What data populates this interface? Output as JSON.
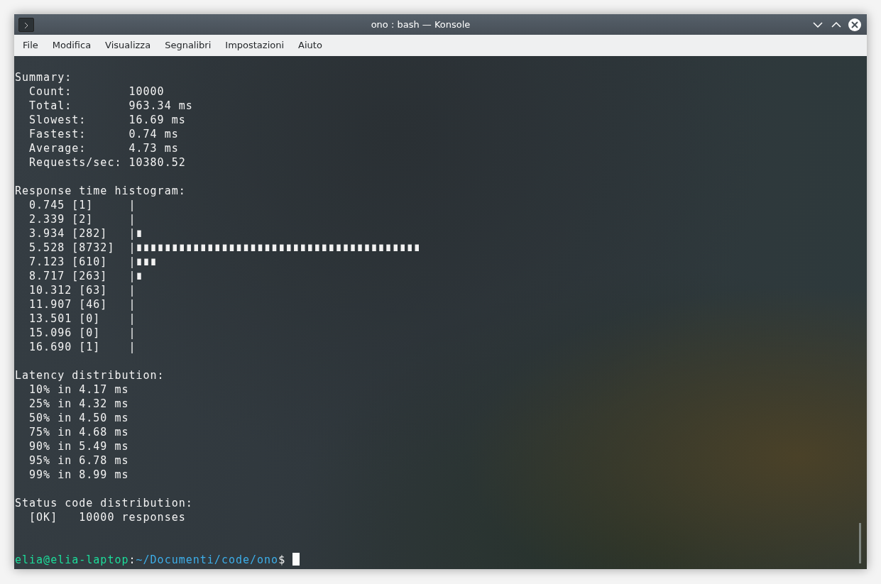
{
  "window": {
    "title": "ono : bash — Konsole"
  },
  "menu": [
    "File",
    "Modifica",
    "Visualizza",
    "Segnalibri",
    "Impostazioni",
    "Aiuto"
  ],
  "terminal": {
    "blocks": [
      [
        "Summary:",
        "  Count:        10000",
        "  Total:        963.34 ms",
        "  Slowest:      16.69 ms",
        "  Fastest:      0.74 ms",
        "  Average:      4.73 ms",
        "  Requests/sec: 10380.52"
      ],
      [
        "Response time histogram:",
        "  0.745 [1]     |",
        "  2.339 [2]     |",
        "  3.934 [282]   |∎",
        "  5.528 [8732]  |∎∎∎∎∎∎∎∎∎∎∎∎∎∎∎∎∎∎∎∎∎∎∎∎∎∎∎∎∎∎∎∎∎∎∎∎∎∎∎∎",
        "  7.123 [610]   |∎∎∎",
        "  8.717 [263]   |∎",
        "  10.312 [63]   |",
        "  11.907 [46]   |",
        "  13.501 [0]    |",
        "  15.096 [0]    |",
        "  16.690 [1]    |"
      ],
      [
        "Latency distribution:",
        "  10% in 4.17 ms",
        "  25% in 4.32 ms",
        "  50% in 4.50 ms",
        "  75% in 4.68 ms",
        "  90% in 5.49 ms",
        "  95% in 6.78 ms",
        "  99% in 8.99 ms"
      ],
      [
        "Status code distribution:",
        "  [OK]   10000 responses"
      ]
    ],
    "prompt": {
      "user_host": "elia@elia-laptop",
      "separator": ":",
      "path": "~/Documenti/code/ono",
      "symbol": "$ "
    }
  }
}
